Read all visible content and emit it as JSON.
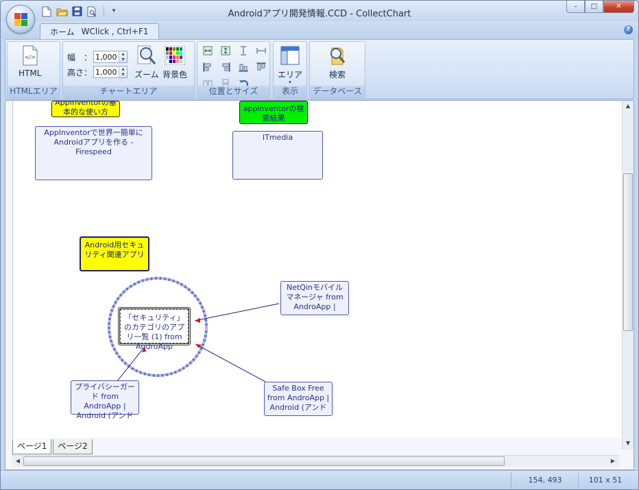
{
  "window": {
    "title": "Androidアプリ開発情報.CCD - CollectChart",
    "controls": {
      "minimize": "–",
      "maximize": "□",
      "close": "✕"
    }
  },
  "quick_access": {
    "icons": [
      "new-file-icon",
      "open-folder-icon",
      "save-icon",
      "print-preview-icon"
    ],
    "more": "▾"
  },
  "ribbon": {
    "tab": {
      "label": "ホーム",
      "hint": "WClick , Ctrl+F1"
    },
    "help": "?",
    "groups": {
      "html_area": {
        "label": "HTMLエリア",
        "html_button": "HTML"
      },
      "chart_area": {
        "label": "チャートエリア",
        "width_label": "幅　：",
        "width_value": "1,000",
        "height_label": "高さ：",
        "height_value": "1,000",
        "zoom_button": "ズーム",
        "bgcolor_button": "背景色"
      },
      "position_size": {
        "label": "位置とサイズ"
      },
      "display": {
        "label": "表示",
        "area_button": "エリア"
      },
      "database": {
        "label": "データベース",
        "search_button": "検索"
      }
    }
  },
  "chart": {
    "nodes": {
      "appinventor_basic": "AppInventorの基本的な使い方",
      "appinventor_firespeed": "AppInventorで世界一簡単にAndroidアプリを作る - Firespeed",
      "appinventor_search": "appinventorの検索結果",
      "itmedia": "ITmedia",
      "android_security": "Android用セキュリティ関連アプリ",
      "security_category": "「セキュリティ」のカテゴリのアプリ一覧 (1) from AndroApp",
      "netqin": "NetQinモバイルマネージャ from AndroApp |",
      "privacy_guard": "プライバシーガード from AndroApp | Android (アンド",
      "safebox": "Safe Box Free from AndroApp | Android (アンド"
    }
  },
  "pages": [
    "ページ1",
    "ページ2"
  ],
  "status": {
    "coords": "154, 493",
    "size": "101 x 51"
  },
  "colors": {
    "node_blue_border": "#4a5ab0",
    "node_yellow": "#ffff00",
    "node_green": "#00ee00",
    "link_line": "#1a1a8c",
    "link_arrow": "#d01818"
  }
}
